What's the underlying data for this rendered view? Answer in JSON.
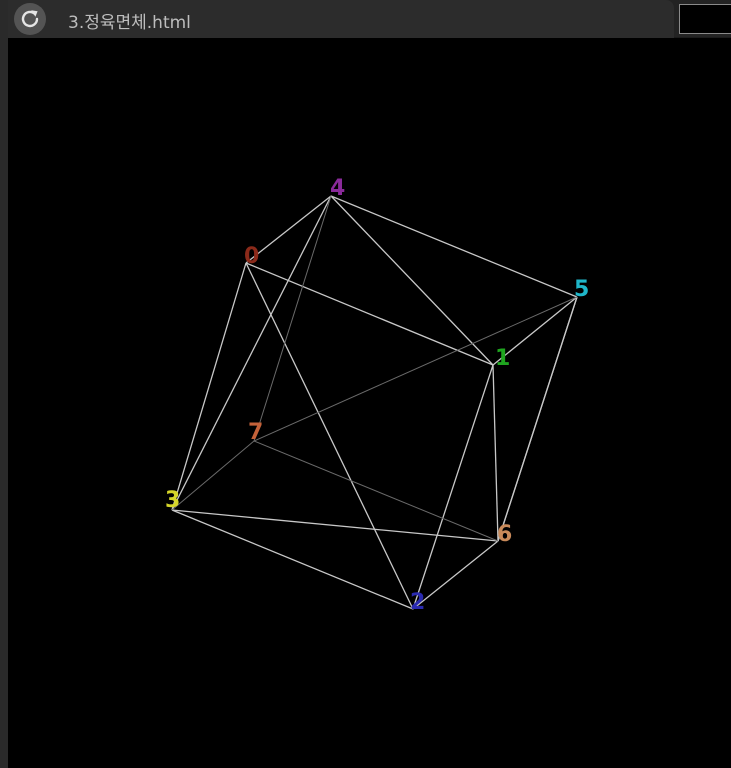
{
  "tab": {
    "title": "3.정육면체.html"
  },
  "scene": {
    "edge_color": "#c8c8c8",
    "back_edge_color": "#6a6a6a",
    "vertices": [
      {
        "id": "0",
        "label": "0",
        "color": "#8b2a1a"
      },
      {
        "id": "1",
        "label": "1",
        "color": "#1fa51f"
      },
      {
        "id": "2",
        "label": "2",
        "color": "#2a2ab0"
      },
      {
        "id": "3",
        "label": "3",
        "color": "#d6d62a"
      },
      {
        "id": "4",
        "label": "4",
        "color": "#8a2a9a"
      },
      {
        "id": "5",
        "label": "5",
        "color": "#1fb6c9"
      },
      {
        "id": "6",
        "label": "6",
        "color": "#c98a5a"
      },
      {
        "id": "7",
        "label": "7",
        "color": "#c4623a"
      }
    ]
  }
}
